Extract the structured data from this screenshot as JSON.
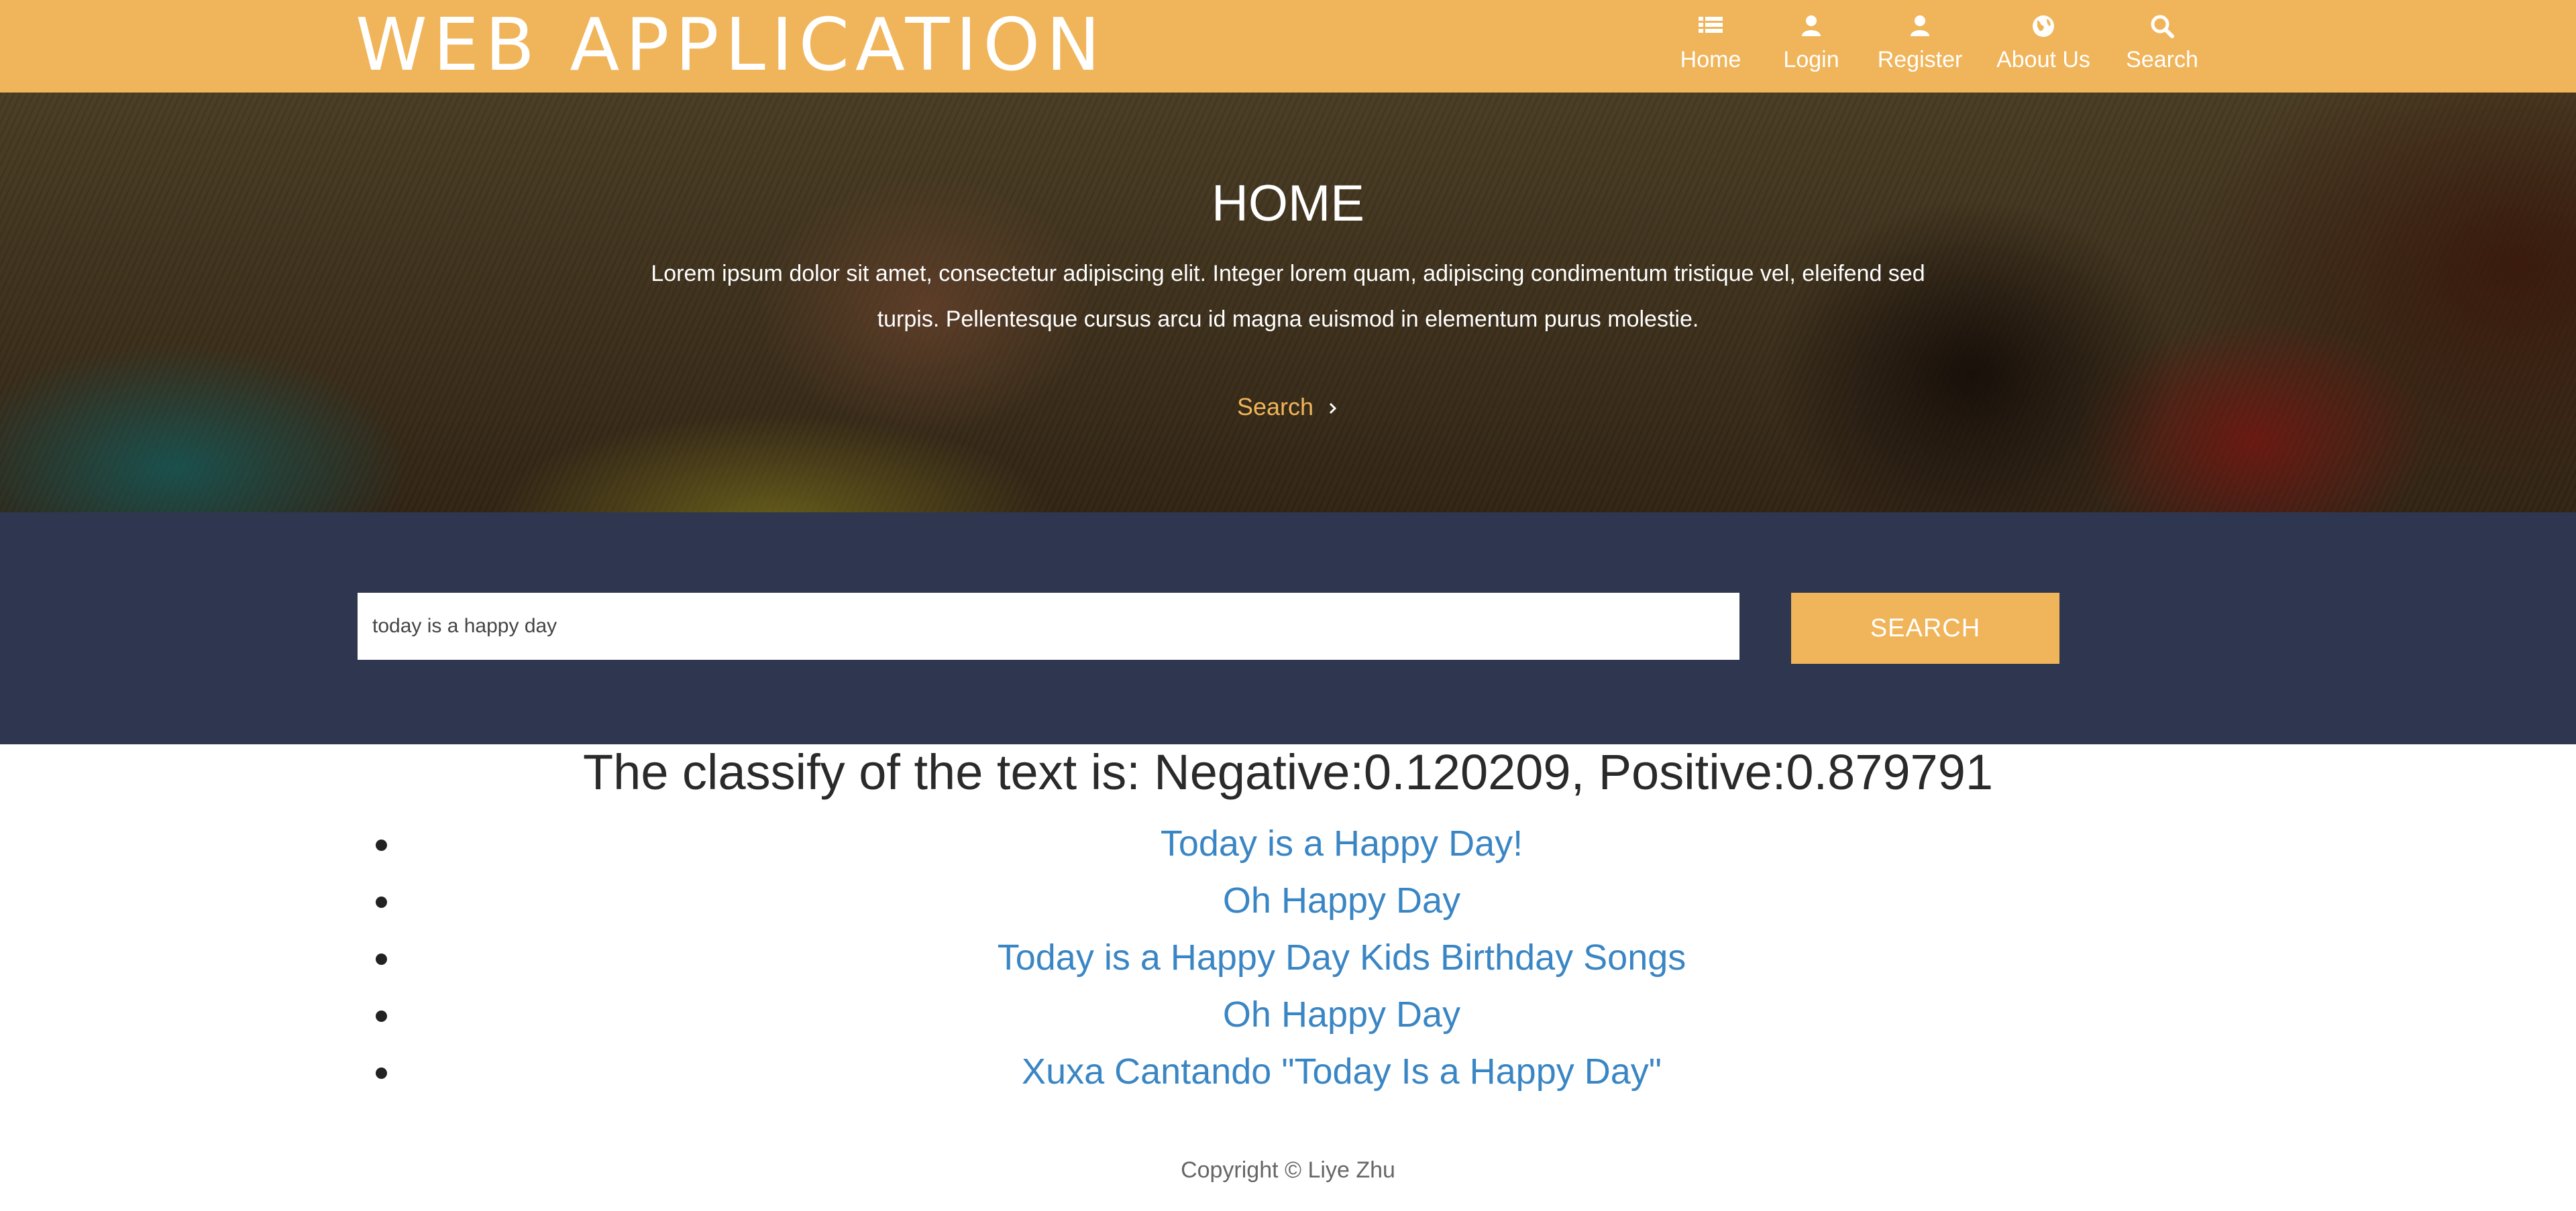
{
  "header": {
    "logo": "WEB APPLICATION",
    "nav": [
      {
        "label": "Home",
        "icon": "list-icon"
      },
      {
        "label": "Login",
        "icon": "user-icon"
      },
      {
        "label": "Register",
        "icon": "user-icon"
      },
      {
        "label": "About Us",
        "icon": "globe-icon"
      },
      {
        "label": "Search",
        "icon": "search-icon"
      }
    ]
  },
  "hero": {
    "title": "HOME",
    "text": "Lorem ipsum dolor sit amet, consectetur adipiscing elit. Integer lorem quam, adipiscing condimentum tristique vel, eleifend sed turpis. Pellentesque cursus arcu id magna euismod in elementum purus molestie.",
    "link_label": "Search",
    "link_icon": "chevron-right-icon"
  },
  "search": {
    "value": "today is a happy day",
    "button_label": "SEARCH"
  },
  "results": {
    "classification": "The classify of the text is: Negative:0.120209, Positive:0.879791",
    "items": [
      "Today is a Happy Day!",
      "Oh Happy Day",
      "Today is a Happy Day Kids Birthday Songs",
      "Oh Happy Day",
      "Xuxa Cantando \"Today Is a Happy Day\""
    ]
  },
  "footer": {
    "copyright": "Copyright © Liye Zhu"
  },
  "colors": {
    "header_bg": "#f0b55a",
    "search_band_bg": "#2e374f",
    "link": "#3a86c4",
    "accent": "#f0b55a"
  }
}
